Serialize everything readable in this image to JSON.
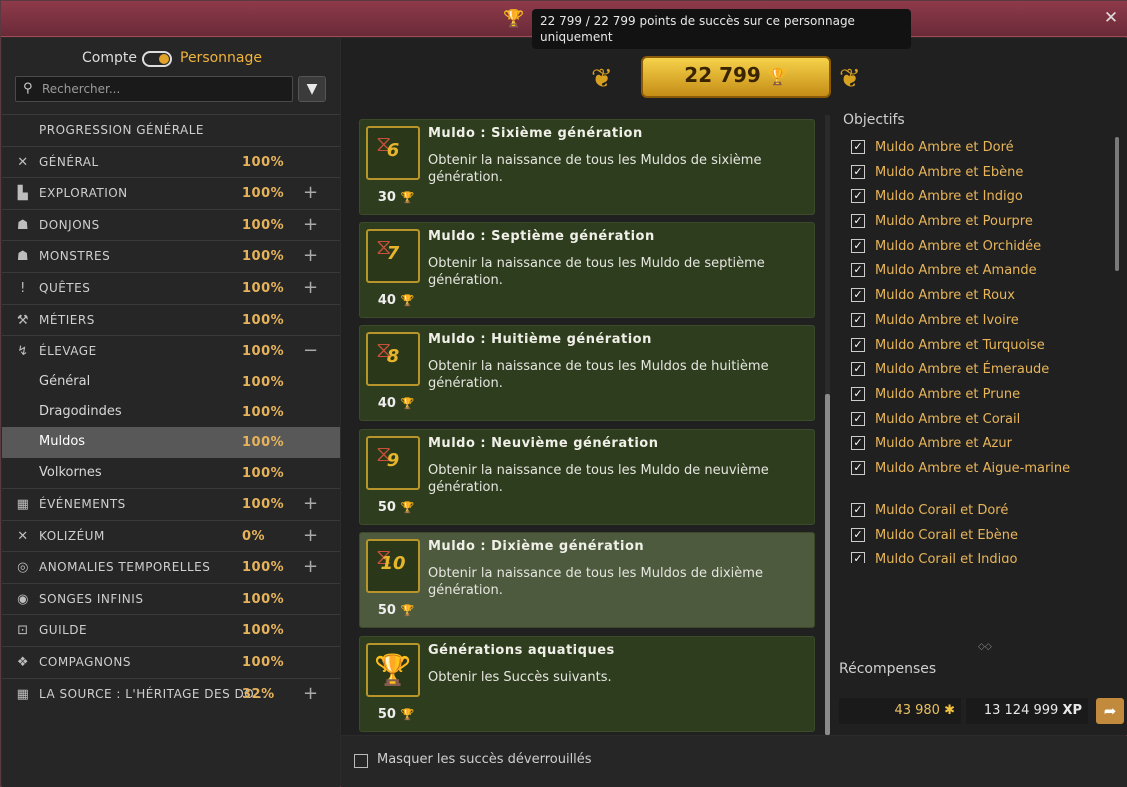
{
  "tooltip": "22 799 / 22 799 points de succès sur ce personnage uniquement",
  "toggle": {
    "left": "Compte",
    "right": "Personnage"
  },
  "search": {
    "placeholder": "Rechercher..."
  },
  "nav": [
    {
      "label": "PROGRESSION GÉNÉRALE",
      "pct": "",
      "icon": "",
      "pm": ""
    },
    {
      "label": "GÉNÉRAL",
      "pct": "100%",
      "icon": "✕",
      "pm": ""
    },
    {
      "label": "EXPLORATION",
      "pct": "100%",
      "icon": "▙",
      "pm": "+"
    },
    {
      "label": "DONJONS",
      "pct": "100%",
      "icon": "☗",
      "pm": "+"
    },
    {
      "label": "MONSTRES",
      "pct": "100%",
      "icon": "☗",
      "pm": "+"
    },
    {
      "label": "QUÊTES",
      "pct": "100%",
      "icon": "!",
      "pm": "+"
    },
    {
      "label": "MÉTIERS",
      "pct": "100%",
      "icon": "⚒",
      "pm": ""
    },
    {
      "label": "ÉLEVAGE",
      "pct": "100%",
      "icon": "↯",
      "pm": "−"
    }
  ],
  "subnav": [
    {
      "label": "Général",
      "pct": "100%"
    },
    {
      "label": "Dragodindes",
      "pct": "100%"
    },
    {
      "label": "Muldos",
      "pct": "100%"
    },
    {
      "label": "Volkornes",
      "pct": "100%"
    }
  ],
  "nav2": [
    {
      "label": "ÉVÉNEMENTS",
      "pct": "100%",
      "icon": "▦",
      "pm": "+"
    },
    {
      "label": "KOLIZÉUM",
      "pct": "0%",
      "icon": "✕",
      "pm": "+"
    },
    {
      "label": "ANOMALIES TEMPORELLES",
      "pct": "100%",
      "icon": "◎",
      "pm": "+"
    },
    {
      "label": "SONGES INFINIS",
      "pct": "100%",
      "icon": "◉",
      "pm": ""
    },
    {
      "label": "GUILDE",
      "pct": "100%",
      "icon": "⊡",
      "pm": ""
    },
    {
      "label": "COMPAGNONS",
      "pct": "100%",
      "icon": "❖",
      "pm": ""
    },
    {
      "label": "LA SOURCE : L'HÉRITAGE DES DO...",
      "pct": "32%",
      "icon": "▦",
      "pm": "+"
    }
  ],
  "score": "22 799",
  "achievements": [
    {
      "title": "Muldo : Sixième génération",
      "desc": "Obtenir la naissance de tous les Muldos de sixième génération.",
      "points": "30",
      "badge": "6"
    },
    {
      "title": "Muldo : Septième génération",
      "desc": "Obtenir la naissance de tous les Muldo de septième génération.",
      "points": "40",
      "badge": "7"
    },
    {
      "title": "Muldo : Huitième génération",
      "desc": "Obtenir la naissance de tous les Muldos de huitième génération.",
      "points": "40",
      "badge": "8"
    },
    {
      "title": "Muldo : Neuvième génération",
      "desc": "Obtenir la naissance de tous les Muldo de neuvième génération.",
      "points": "50",
      "badge": "9"
    },
    {
      "title": "Muldo : Dixième génération",
      "desc": "Obtenir la naissance de tous les Muldos de dixième génération.",
      "points": "50",
      "badge": "10"
    },
    {
      "title": "Générations aquatiques",
      "desc": "Obtenir les Succès suivants.",
      "points": "50",
      "badge": ""
    }
  ],
  "objectives_title": "Objectifs",
  "objectives": [
    "Muldo Ambre et Doré",
    "Muldo Ambre et Ebène",
    "Muldo Ambre et Indigo",
    "Muldo Ambre et Pourpre",
    "Muldo Ambre et Orchidée",
    "Muldo Ambre et Amande",
    "Muldo Ambre et Roux",
    "Muldo Ambre et Ivoire",
    "Muldo Ambre et Turquoise",
    "Muldo Ambre et Émeraude",
    "Muldo Ambre et Prune",
    "Muldo Ambre et Corail",
    "Muldo Ambre et Azur",
    "Muldo Ambre et Aigue-marine",
    "Muldo Corail et Doré",
    "Muldo Corail et Ebène",
    "Muldo Corail et Indigo"
  ],
  "rewards_title": "Récompenses",
  "rewards": {
    "kamas": "43 980",
    "xp": "13 124 999"
  },
  "reward_units": {
    "xp": "XP"
  },
  "hide_unlocked": "Masquer les succès déverrouillés",
  "colors": {
    "accent": "#f0b33b",
    "card": "#2f3d1f",
    "titlebar": "#7a3040"
  }
}
